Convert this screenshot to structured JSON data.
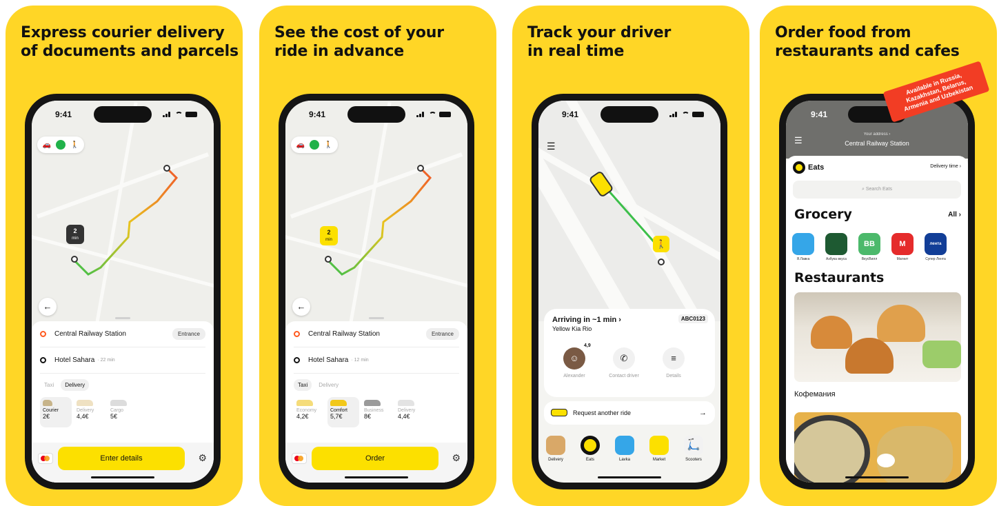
{
  "panels": [
    {
      "headline": [
        "Express courier delivery",
        "of documents and parcels"
      ],
      "status_time": "9:41",
      "eta": {
        "value": "2",
        "unit": "min"
      },
      "from": "Central Railway Station",
      "from_chip": "Entrance",
      "to": "Hotel Sahara",
      "to_meta": "· 22 min",
      "tabs": [
        "Taxi",
        "Delivery"
      ],
      "active_tab": "Delivery",
      "tariffs": [
        {
          "name": "Courier",
          "price": "2€"
        },
        {
          "name": "Delivery",
          "price": "4,4€"
        },
        {
          "name": "Cargo",
          "price": "5€"
        }
      ],
      "cta": "Enter details"
    },
    {
      "headline": [
        "See the cost of your",
        "ride in advance"
      ],
      "status_time": "9:41",
      "eta": {
        "value": "2",
        "unit": "min"
      },
      "from": "Central Railway Station",
      "from_chip": "Entrance",
      "to": "Hotel Sahara",
      "to_meta": "· 12 min",
      "tabs": [
        "Taxi",
        "Delivery"
      ],
      "active_tab": "Taxi",
      "tariffs": [
        {
          "name": "Economy",
          "price": "4,2€"
        },
        {
          "name": "Comfort",
          "price": "5,7€"
        },
        {
          "name": "Business",
          "price": "8€"
        },
        {
          "name": "Delivery",
          "price": "4,4€"
        }
      ],
      "cta": "Order"
    },
    {
      "headline": [
        "Track your driver",
        "in real time"
      ],
      "status_time": "9:41",
      "arriving": "Arriving in ~1 min ›",
      "car": "Yellow Kia Rio",
      "plate": "ABC0123",
      "rating": "4,9",
      "actions": [
        "Alexander",
        "Contact driver",
        "Details"
      ],
      "request": "Request another ride",
      "services": [
        "Delivery",
        "Eats",
        "Lavka",
        "Market",
        "Scooters"
      ]
    },
    {
      "headline": [
        "Order food from",
        "restaurants and cafes"
      ],
      "badge": [
        "Available in Russia,",
        "Kazakhstan, Belarus,",
        "Armenia and Uzbekistan"
      ],
      "status_time": "9:41",
      "address_label": "Your address ›",
      "address": "Central Railway Station",
      "app_name": "Eats",
      "delivery_time": "Delivery time ›",
      "search_placeholder": "Search Eats",
      "grocery_title": "Grocery",
      "all": "All ›",
      "shops": [
        {
          "name": "Я.Лавка",
          "mark": "",
          "color": "#35a6e8"
        },
        {
          "name": "Азбука вкуса",
          "mark": "",
          "color": "#1e5a32"
        },
        {
          "name": "ВкусВилл",
          "mark": "BB",
          "color": "#4cb96b"
        },
        {
          "name": "Магнит",
          "mark": "M",
          "color": "#e52b2b"
        },
        {
          "name": "Супер Лента",
          "mark": "лента",
          "color": "#123e97"
        }
      ],
      "restaurants_title": "Restaurants",
      "restaurant": "Кофемания"
    }
  ]
}
